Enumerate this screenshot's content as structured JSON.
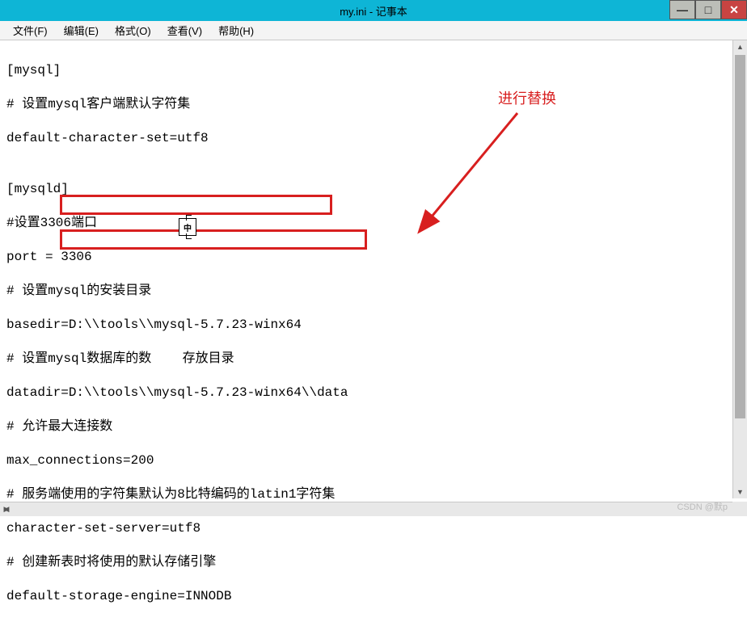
{
  "window": {
    "title": "my.ini - 记事本"
  },
  "menu": {
    "file": "文件(F)",
    "edit": "编辑(E)",
    "format": "格式(O)",
    "view": "查看(V)",
    "help": "帮助(H)"
  },
  "lines": {
    "l1": "[mysql]",
    "l2": "# 设置mysql客户端默认字符集",
    "l3": "default-character-set=utf8",
    "l4": "",
    "l5": "[mysqld]",
    "l6": "#设置3306端口",
    "l7": "port = 3306",
    "l8": "# 设置mysql的安装目录",
    "l9": "basedir=D:\\\\tools\\\\mysql-5.7.23-winx64",
    "l10": "# 设置mysql数据库的数    存放目录",
    "l11": "datadir=D:\\\\tools\\\\mysql-5.7.23-winx64\\\\data",
    "l12": "# 允许最大连接数",
    "l13": "max_connections=200",
    "l14": "# 服务端使用的字符集默认为8比特编码的latin1字符集",
    "l15": "character-set-server=utf8",
    "l16": "# 创建新表时将使用的默认存储引擎",
    "l17": "default-storage-engine=INNODB"
  },
  "annotation": {
    "text": "进行替换",
    "cursor_char": "中"
  },
  "watermark": "CSDN @默p"
}
